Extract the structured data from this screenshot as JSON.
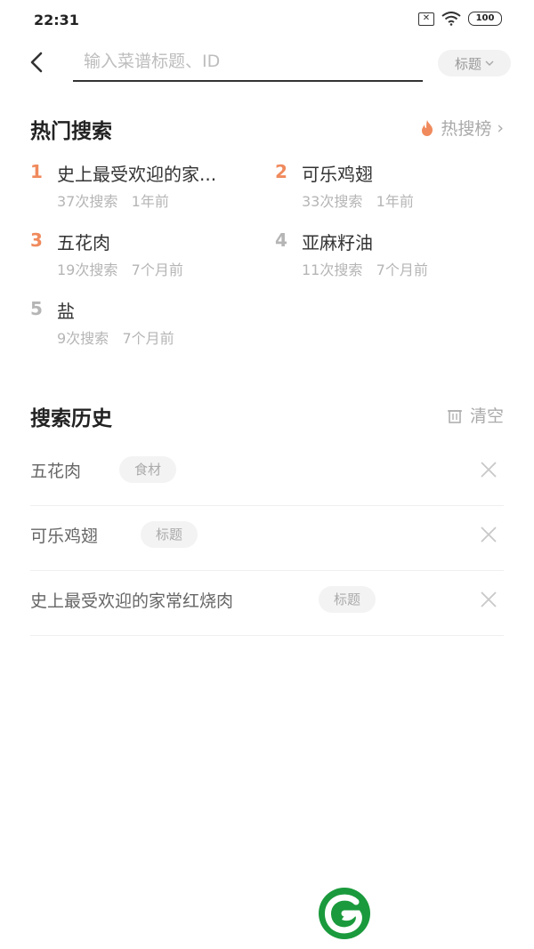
{
  "status_bar": {
    "time": "22:31",
    "battery": "100"
  },
  "search": {
    "placeholder": "输入菜谱标题、ID",
    "filter_label": "标题"
  },
  "hot_search": {
    "title": "热门搜索",
    "rank_link": "热搜榜",
    "items": [
      {
        "rank": "1",
        "name": "史上最受欢迎的家...",
        "count": "37次搜索",
        "time": "1年前",
        "rank_color": "#f08a5d"
      },
      {
        "rank": "2",
        "name": "可乐鸡翅",
        "count": "33次搜索",
        "time": "1年前",
        "rank_color": "#f08a5d"
      },
      {
        "rank": "3",
        "name": "五花肉",
        "count": "19次搜索",
        "time": "7个月前",
        "rank_color": "#f08a5d"
      },
      {
        "rank": "4",
        "name": "亚麻籽油",
        "count": "11次搜索",
        "time": "7个月前",
        "rank_color": "#b5b5b5"
      },
      {
        "rank": "5",
        "name": "盐",
        "count": "9次搜索",
        "time": "7个月前",
        "rank_color": "#b5b5b5"
      }
    ]
  },
  "history": {
    "title": "搜索历史",
    "clear_label": "清空",
    "items": [
      {
        "text": "五花肉",
        "tag": "食材"
      },
      {
        "text": "可乐鸡翅",
        "tag": "标题"
      },
      {
        "text": "史上最受欢迎的家常红烧肉",
        "tag": "标题"
      }
    ]
  },
  "colors": {
    "accent": "#f08a5d",
    "logo_green": "#1a9a3c"
  },
  "icons": {
    "back": "chevron-left-icon",
    "fire": "fire-icon",
    "trash": "trash-icon",
    "delete": "close-icon",
    "logo": "app-logo"
  }
}
